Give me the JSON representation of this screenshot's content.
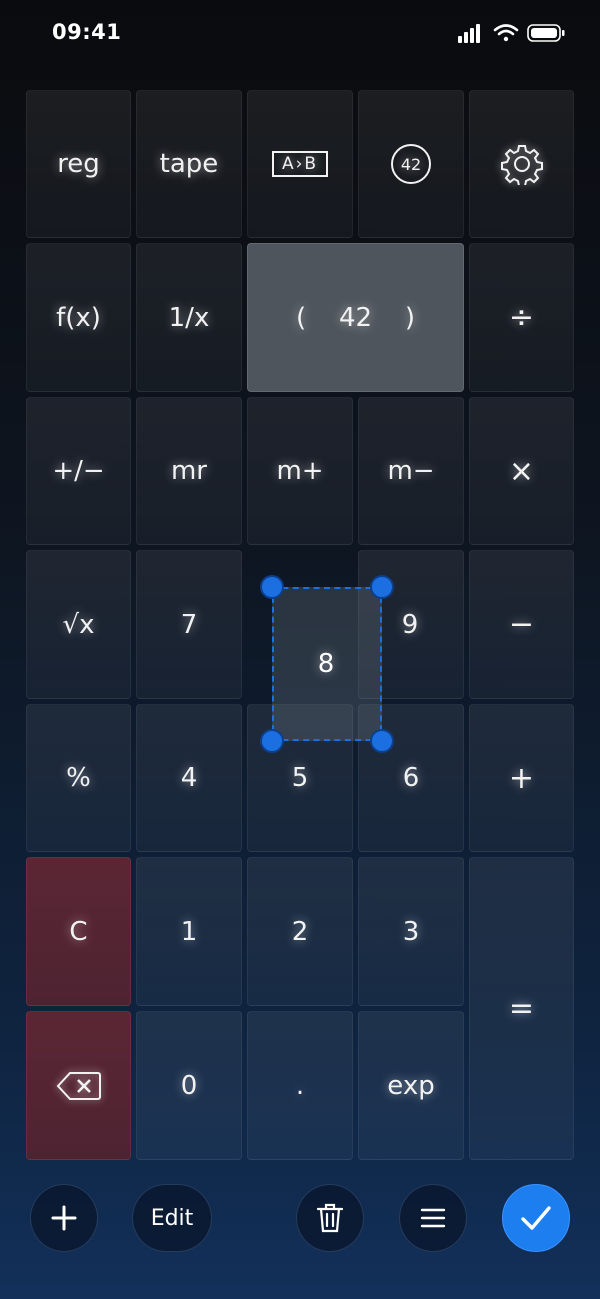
{
  "status_bar": {
    "time": "09:41"
  },
  "keys": {
    "reg": "reg",
    "tape": "tape",
    "ab": "A›B",
    "badge": "42",
    "fx": "f(x)",
    "inverse": "1/x",
    "display_open": "(",
    "display_value": "42",
    "display_close": ")",
    "divide": "÷",
    "plus_minus": "+/−",
    "mr": "mr",
    "m_plus": "m+",
    "m_minus": "m−",
    "multiply": "×",
    "sqrt": "√x",
    "seven": "7",
    "eight": "8",
    "nine": "9",
    "minus": "−",
    "percent": "%",
    "four": "4",
    "five": "5",
    "six": "6",
    "plus": "+",
    "clear": "C",
    "one": "1",
    "two": "2",
    "three": "3",
    "equals": "=",
    "zero": "0",
    "decimal": ".",
    "exp": "exp"
  },
  "toolbar": {
    "edit_label": "Edit"
  },
  "icons": [
    "signal-icon",
    "wifi-icon",
    "battery-icon",
    "ab-swap-icon",
    "settings-icon",
    "backspace-icon",
    "plus-icon",
    "trash-icon",
    "menu-icon",
    "checkmark-icon"
  ],
  "colors": {
    "accent": "#1d7ef0",
    "clear_key": "#5b2634",
    "display": "#4f555c"
  }
}
